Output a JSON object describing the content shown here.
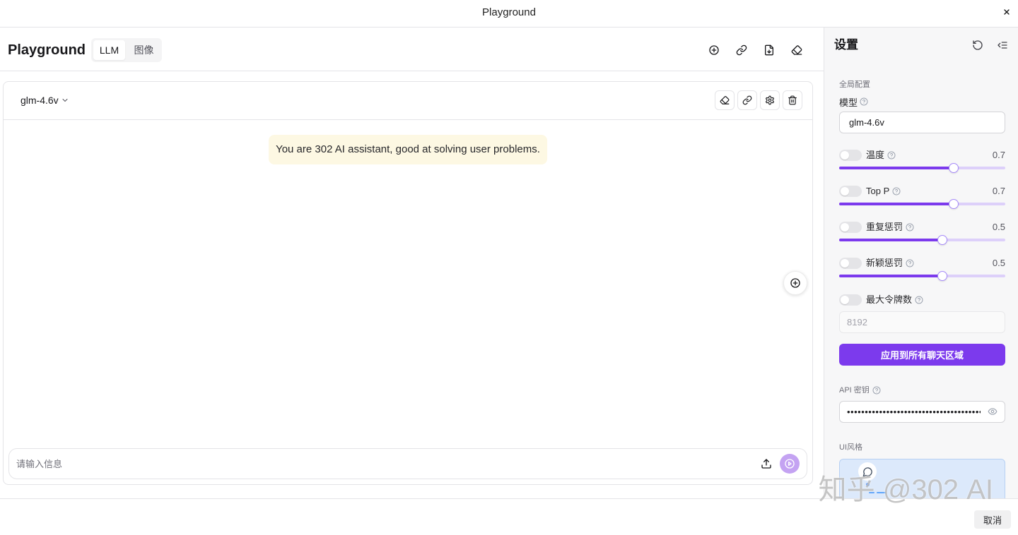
{
  "window": {
    "title": "Playground",
    "close_icon": "close-icon"
  },
  "header": {
    "title": "Playground",
    "tabs": [
      {
        "label": "LLM",
        "active": true
      },
      {
        "label": "图像",
        "active": false
      }
    ],
    "action_icons": [
      "plus-circle-icon",
      "link-icon",
      "file-export-icon",
      "eraser-icon"
    ]
  },
  "chat": {
    "model": "glm-4.6v",
    "model_icon": "chevron-down-icon",
    "toolbar_icons": [
      "eraser-icon",
      "link-icon",
      "gear-icon",
      "trash-icon"
    ],
    "system_message": "You are 302 AI assistant, good at solving user problems.",
    "floating_icon": "plus-circle-icon",
    "input": {
      "placeholder": "请输入信息"
    },
    "input_icons": [
      "upload-icon",
      "send-icon"
    ]
  },
  "settings": {
    "title": "设置",
    "header_icons": [
      "rotate-ccw-icon",
      "list-collapse-icon"
    ],
    "global_section": "全局配置",
    "model": {
      "label": "模型",
      "value": "glm-4.6v"
    },
    "params": [
      {
        "label": "温度",
        "value": "0.7",
        "enabled": false,
        "level": 0.69
      },
      {
        "label": "Top P",
        "value": "0.7",
        "enabled": false,
        "level": 0.69
      },
      {
        "label": "重复惩罚",
        "value": "0.5",
        "enabled": false,
        "level": 0.62
      },
      {
        "label": "新颖惩罚",
        "value": "0.5",
        "enabled": false,
        "level": 0.62
      }
    ],
    "max_tokens": {
      "label": "最大令牌数",
      "enabled": false,
      "placeholder": "8192"
    },
    "apply_button": "应用到所有聊天区域",
    "api_key": {
      "label": "API 密钥",
      "masked_value": "••••••••••••••••••••••••••••••••••••••••"
    },
    "ui_style": {
      "label": "UI风格",
      "icon": "message-circle-icon"
    }
  },
  "footer": {
    "cancel_label": "取消"
  },
  "watermark": "知乎 @302 AI",
  "colors": {
    "accent": "#7c3aed",
    "accent_light": "#ddd0fa",
    "send_button": "#c4a3f2",
    "system_bubble": "#fdf8e3",
    "panel_bg": "#f7f7f8",
    "preview_bg": "#dce9fb"
  }
}
